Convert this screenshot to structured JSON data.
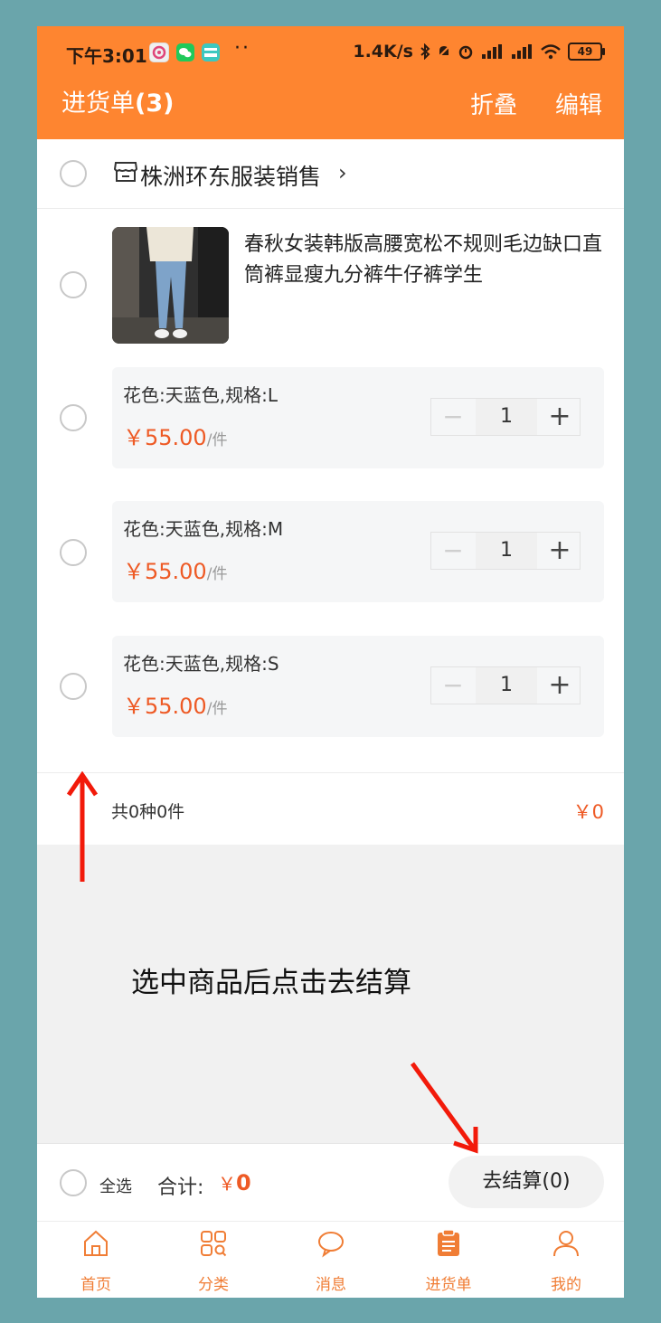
{
  "status_bar": {
    "time": "下午3:01",
    "network_speed": "1.4K/s",
    "battery": "49"
  },
  "header": {
    "title": "进货单",
    "count": "(3)",
    "fold_label": "折叠",
    "edit_label": "编辑"
  },
  "shop": {
    "name": "株洲环东服装销售",
    "chevron": "›"
  },
  "product": {
    "title": "春秋女装韩版高腰宽松不规则毛边缺口直筒裤显瘦九分裤牛仔裤学生",
    "skus": [
      {
        "spec": "花色:天蓝色,规格:L",
        "price": "￥55.00",
        "unit": "/件",
        "qty": "1"
      },
      {
        "spec": "花色:天蓝色,规格:M",
        "price": "￥55.00",
        "unit": "/件",
        "qty": "1"
      },
      {
        "spec": "花色:天蓝色,规格:S",
        "price": "￥55.00",
        "unit": "/件",
        "qty": "1"
      }
    ],
    "minus_symbol": "−",
    "plus_symbol": "+"
  },
  "summary": {
    "count_text": "共0种0件",
    "amount": "￥0"
  },
  "annotation": {
    "hint": "选中商品后点击去结算",
    "arrow_color": "#f21a0a"
  },
  "footer": {
    "select_all": "全选",
    "total_label": "合计:",
    "currency": "￥",
    "total_value": "0",
    "checkout_label": "去结算(0)"
  },
  "tabs": [
    {
      "label": "首页",
      "icon": "home-icon"
    },
    {
      "label": "分类",
      "icon": "category-icon"
    },
    {
      "label": "消息",
      "icon": "message-icon"
    },
    {
      "label": "进货单",
      "icon": "clipboard-icon",
      "active": true
    },
    {
      "label": "我的",
      "icon": "user-icon"
    }
  ],
  "colors": {
    "accent": "#fe8530",
    "price": "#ee5a25",
    "background": "#6aa5ab"
  }
}
